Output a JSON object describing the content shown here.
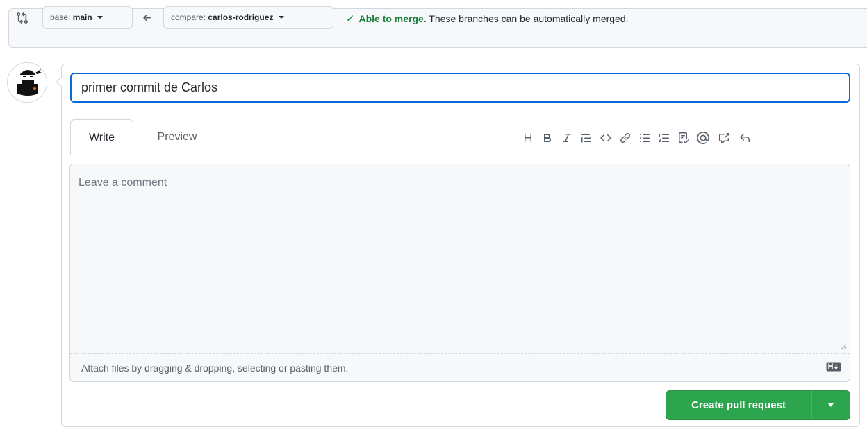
{
  "range_bar": {
    "base_label": "base:",
    "base_value": "main",
    "compare_label": "compare:",
    "compare_value": "carlos-rodriguez",
    "merge_ok": "Able to merge.",
    "merge_detail": "These branches can be automatically merged."
  },
  "composer": {
    "title_value": "primer commit de Carlos",
    "tabs": [
      {
        "label": "Write"
      },
      {
        "label": "Preview"
      }
    ],
    "toolbar": [
      "heading-icon",
      "bold-icon",
      "italic-icon",
      "quote-icon",
      "code-icon",
      "link-icon",
      "unordered-list-icon",
      "ordered-list-icon",
      "task-list-icon",
      "mention-icon",
      "cross-reference-icon",
      "reply-icon"
    ],
    "comment_placeholder": "Leave a comment",
    "attach_text": "Attach files by dragging & dropping, selecting or pasting them."
  },
  "actions": {
    "create_label": "Create pull request"
  },
  "colors": {
    "accent_blue": "#0969da",
    "success_green": "#1a7f37",
    "button_green": "#2da44e"
  }
}
